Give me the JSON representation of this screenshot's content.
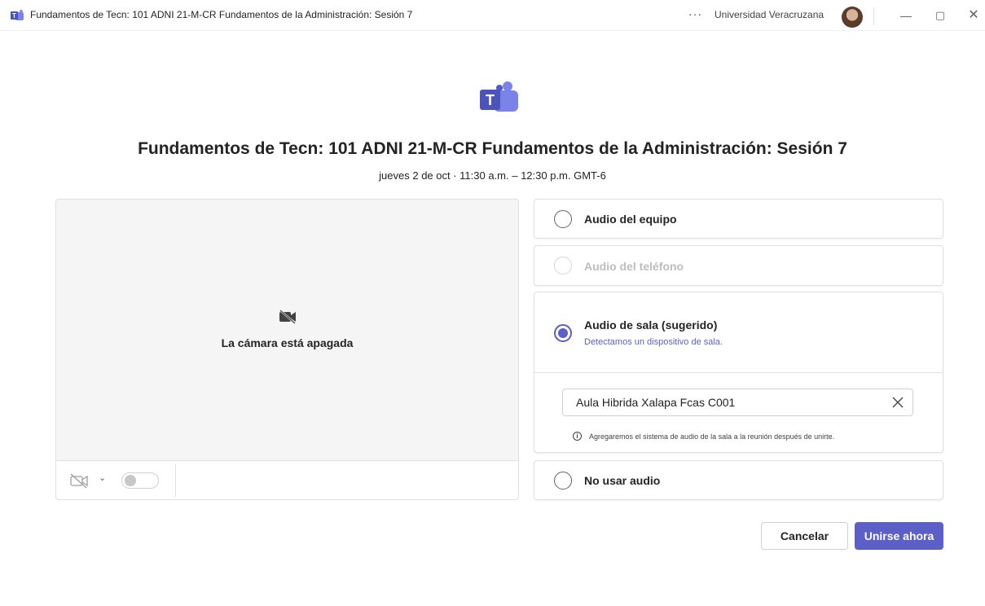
{
  "window": {
    "title": "Fundamentos de Tecn: 101 ADNI 21-M-CR Fundamentos de la Administración: Sesión 7",
    "more_icon": "more-horizontal-icon",
    "org_name": "Universidad Veracruzana",
    "minimize_glyph": "—",
    "maximize_glyph": "▢",
    "close_glyph": "✕"
  },
  "meeting": {
    "title": "Fundamentos de Tecn: 101 ADNI 21-M-CR Fundamentos de la Administración: Sesión 7",
    "time": "jueves 2 de oct  ·  11:30 a.m.  –  12:30 p.m. GMT-6"
  },
  "video": {
    "camera_off_text": "La cámara está apagada",
    "camera_toggle_on": false
  },
  "audio_options": [
    {
      "label": "Audio del equipo",
      "selected": false,
      "disabled": false
    },
    {
      "label": "Audio del teléfono",
      "selected": false,
      "disabled": true
    },
    {
      "label": "Audio de sala (sugerido)",
      "sublabel": "Detectamos un dispositivo de sala.",
      "selected": true,
      "disabled": false
    },
    {
      "label": "No usar audio",
      "selected": false,
      "disabled": false
    }
  ],
  "room": {
    "value": "Aula Hibrida Xalapa Fcas C001",
    "note": "Agregaremos el sistema de audio de la sala a la reunión después de unirte."
  },
  "actions": {
    "cancel_label": "Cancelar",
    "join_label": "Unirse ahora"
  },
  "colors": {
    "accent": "#5b5fc7",
    "text": "#242424",
    "border": "#e0e0e0"
  }
}
